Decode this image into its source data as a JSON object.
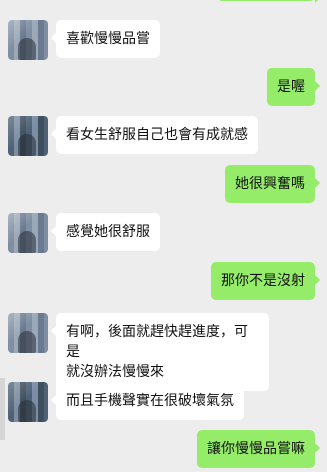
{
  "messages": [
    {
      "side": "out",
      "text": ""
    },
    {
      "side": "in",
      "text": "喜歡慢慢品嘗"
    },
    {
      "side": "out",
      "text": "是喔"
    },
    {
      "side": "in",
      "text": "看女生舒服自己也會有成就感"
    },
    {
      "side": "out",
      "text": "她很興奮嗎"
    },
    {
      "side": "in",
      "text": "感覺她很舒服"
    },
    {
      "side": "out",
      "text": "那你不是沒射"
    },
    {
      "side": "in",
      "text": "有啊，後面就趕快趕進度，可是\n就沒辦法慢慢來"
    },
    {
      "side": "in",
      "text": "而且手機聲實在很破壞氣氛"
    },
    {
      "side": "out",
      "text": "讓你慢慢品嘗嘛"
    }
  ],
  "colors": {
    "background": "#ededed",
    "incoming_bubble": "#ffffff",
    "outgoing_bubble": "#95ec69"
  }
}
